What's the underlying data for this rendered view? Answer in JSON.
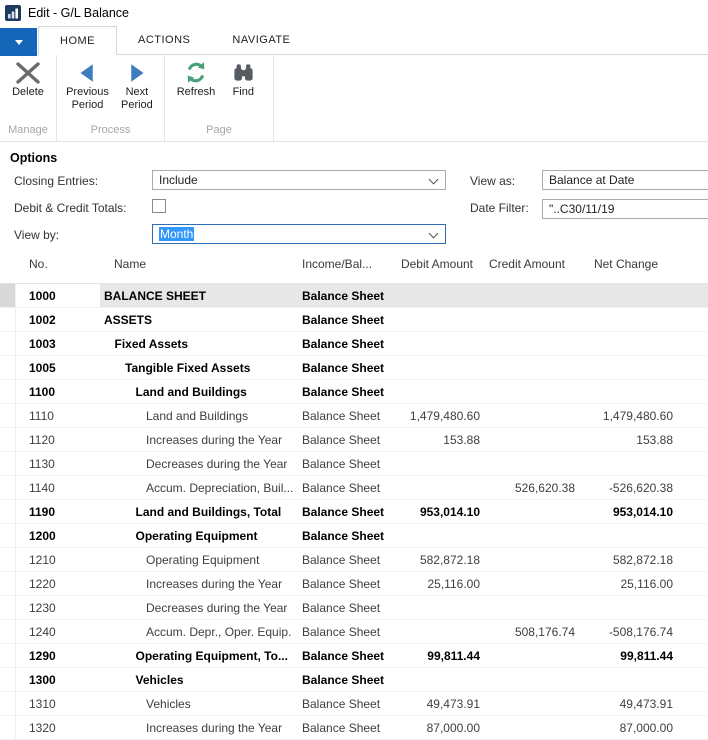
{
  "window": {
    "title": "Edit - G/L Balance",
    "icon": "bar-chart-icon"
  },
  "ribbon": {
    "tabs": [
      {
        "label": "HOME",
        "active": true
      },
      {
        "label": "ACTIONS",
        "active": false
      },
      {
        "label": "NAVIGATE",
        "active": false
      }
    ],
    "groups": [
      {
        "label": "Manage",
        "buttons": [
          {
            "label": "Delete",
            "lines": [
              "Delete"
            ],
            "icon": "delete-x-icon",
            "color": "#6b6b6b"
          }
        ]
      },
      {
        "label": "Process",
        "buttons": [
          {
            "label": "Previous Period",
            "lines": [
              "Previous",
              "Period"
            ],
            "icon": "previous-triangle-icon",
            "color": "#3e7dbd"
          },
          {
            "label": "Next Period",
            "lines": [
              "Next",
              "Period"
            ],
            "icon": "next-triangle-icon",
            "color": "#3e7dbd"
          }
        ]
      },
      {
        "label": "Page",
        "buttons": [
          {
            "label": "Refresh",
            "lines": [
              "Refresh"
            ],
            "icon": "refresh-icon",
            "color": "#47a077"
          },
          {
            "label": "Find",
            "lines": [
              "Find"
            ],
            "icon": "binoculars-icon",
            "color": "#575c63"
          }
        ]
      }
    ]
  },
  "options": {
    "section_title": "Options",
    "closing_entries": {
      "label": "Closing Entries:",
      "value": "Include"
    },
    "debit_credit_totals": {
      "label": "Debit & Credit Totals:",
      "checked": false
    },
    "view_by": {
      "label": "View by:",
      "value": "Month",
      "focused": true
    },
    "view_as": {
      "label": "View as:",
      "value": "Balance at Date"
    },
    "date_filter": {
      "label": "Date Filter:",
      "value": "\"..C30/11/19"
    }
  },
  "grid": {
    "columns": [
      "No.",
      "Name",
      "Income/Bal...",
      "Debit Amount",
      "Credit Amount",
      "Net Change"
    ],
    "rows": [
      {
        "no": "1000",
        "name": "BALANCE SHEET",
        "income": "Balance Sheet",
        "debit": "",
        "credit": "",
        "net": "",
        "bold": true,
        "indent": 0,
        "selected": true
      },
      {
        "no": "1002",
        "name": "ASSETS",
        "income": "Balance Sheet",
        "debit": "",
        "credit": "",
        "net": "",
        "bold": true,
        "indent": 0
      },
      {
        "no": "1003",
        "name": "Fixed Assets",
        "income": "Balance Sheet",
        "debit": "",
        "credit": "",
        "net": "",
        "bold": true,
        "indent": 1
      },
      {
        "no": "1005",
        "name": "Tangible Fixed Assets",
        "income": "Balance Sheet",
        "debit": "",
        "credit": "",
        "net": "",
        "bold": true,
        "indent": 2
      },
      {
        "no": "1100",
        "name": "Land and Buildings",
        "income": "Balance Sheet",
        "debit": "",
        "credit": "",
        "net": "",
        "bold": true,
        "indent": 3
      },
      {
        "no": "1110",
        "name": "Land and Buildings",
        "income": "Balance Sheet",
        "debit": "1,479,480.60",
        "credit": "",
        "net": "1,479,480.60",
        "bold": false,
        "indent": 4
      },
      {
        "no": "1120",
        "name": "Increases during the Year",
        "income": "Balance Sheet",
        "debit": "153.88",
        "credit": "",
        "net": "153.88",
        "bold": false,
        "indent": 4
      },
      {
        "no": "1130",
        "name": "Decreases during the Year",
        "income": "Balance Sheet",
        "debit": "",
        "credit": "",
        "net": "",
        "bold": false,
        "indent": 4
      },
      {
        "no": "1140",
        "name": "Accum. Depreciation, Buil...",
        "income": "Balance Sheet",
        "debit": "",
        "credit": "526,620.38",
        "net": "-526,620.38",
        "bold": false,
        "indent": 4
      },
      {
        "no": "1190",
        "name": "Land and Buildings, Total",
        "income": "Balance Sheet",
        "debit": "953,014.10",
        "credit": "",
        "net": "953,014.10",
        "bold": true,
        "indent": 3
      },
      {
        "no": "1200",
        "name": "Operating Equipment",
        "income": "Balance Sheet",
        "debit": "",
        "credit": "",
        "net": "",
        "bold": true,
        "indent": 3
      },
      {
        "no": "1210",
        "name": "Operating Equipment",
        "income": "Balance Sheet",
        "debit": "582,872.18",
        "credit": "",
        "net": "582,872.18",
        "bold": false,
        "indent": 4
      },
      {
        "no": "1220",
        "name": "Increases during the Year",
        "income": "Balance Sheet",
        "debit": "25,116.00",
        "credit": "",
        "net": "25,116.00",
        "bold": false,
        "indent": 4
      },
      {
        "no": "1230",
        "name": "Decreases during the Year",
        "income": "Balance Sheet",
        "debit": "",
        "credit": "",
        "net": "",
        "bold": false,
        "indent": 4
      },
      {
        "no": "1240",
        "name": "Accum. Depr., Oper. Equip.",
        "income": "Balance Sheet",
        "debit": "",
        "credit": "508,176.74",
        "net": "-508,176.74",
        "bold": false,
        "indent": 4
      },
      {
        "no": "1290",
        "name": "Operating Equipment, To...",
        "income": "Balance Sheet",
        "debit": "99,811.44",
        "credit": "",
        "net": "99,811.44",
        "bold": true,
        "indent": 3
      },
      {
        "no": "1300",
        "name": "Vehicles",
        "income": "Balance Sheet",
        "debit": "",
        "credit": "",
        "net": "",
        "bold": true,
        "indent": 3
      },
      {
        "no": "1310",
        "name": "Vehicles",
        "income": "Balance Sheet",
        "debit": "49,473.91",
        "credit": "",
        "net": "49,473.91",
        "bold": false,
        "indent": 4
      },
      {
        "no": "1320",
        "name": "Increases during the Year",
        "income": "Balance Sheet",
        "debit": "87,000.00",
        "credit": "",
        "net": "87,000.00",
        "bold": false,
        "indent": 4
      }
    ]
  },
  "colors": {
    "app_button_blue": "#1467b8",
    "selection_blue": "#3297fd",
    "selected_row_gray": "#e7e7e7",
    "row_gutter_gray": "#d8d8d8",
    "refresh_green": "#47a077",
    "nav_triangle_blue": "#3e7dbd",
    "title_icon_navy": "#1d3a5f"
  }
}
